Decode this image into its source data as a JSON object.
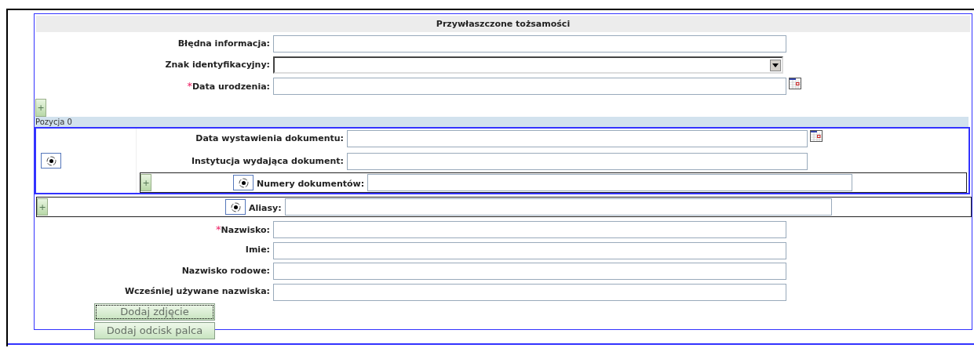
{
  "section_title": "Przywłaszczone tożsamości",
  "required_mark": "*",
  "add_label": "+",
  "top_fields": [
    {
      "label": "Błędna informacja:",
      "kind": "text",
      "required": false
    },
    {
      "label": "Znak identyfikacyjny:",
      "kind": "select",
      "required": false
    },
    {
      "label": "Data urodzenia:",
      "kind": "date",
      "required": true
    }
  ],
  "item_header": "Pozycja 0",
  "item": {
    "radio_selected": true,
    "fields": [
      {
        "label": "Data wystawienia dokumentu:",
        "kind": "date"
      },
      {
        "label": "Instytucja wydająca dokument:",
        "kind": "text"
      }
    ],
    "numbers": {
      "label": "Numery dokumentów:",
      "radio_selected": true
    }
  },
  "aliases": {
    "label": "Aliasy:",
    "radio_selected": true
  },
  "name_fields": [
    {
      "label": "Nazwisko:",
      "required": true
    },
    {
      "label": "Imie:",
      "required": false
    },
    {
      "label": "Nazwisko rodowe:",
      "required": false
    },
    {
      "label": "Wcześniej używane nazwiska:",
      "required": false
    }
  ],
  "buttons": [
    {
      "label": "Dodaj zdjęcie",
      "focused": true
    },
    {
      "label": "Dodaj odcisk palca",
      "focused": false
    }
  ]
}
